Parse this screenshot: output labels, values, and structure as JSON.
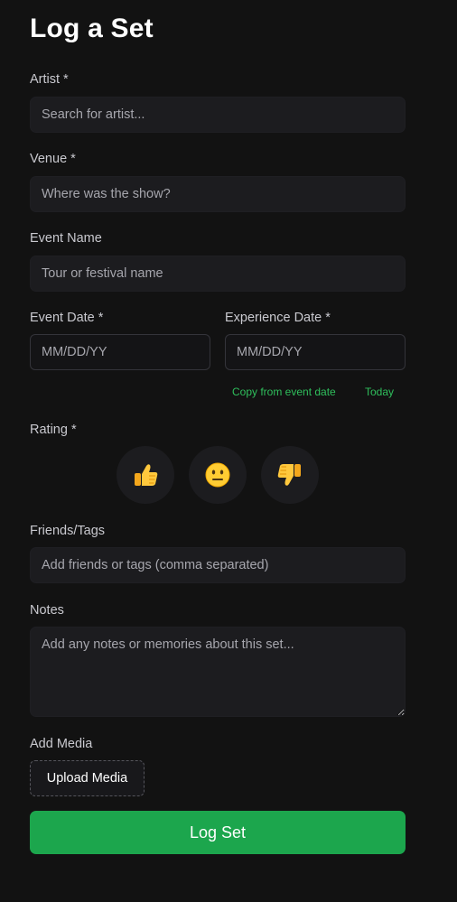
{
  "title": "Log a Set",
  "artist": {
    "label": "Artist *",
    "placeholder": "Search for artist..."
  },
  "venue": {
    "label": "Venue *",
    "placeholder": "Where was the show?"
  },
  "event_name": {
    "label": "Event Name",
    "placeholder": "Tour or festival name"
  },
  "event_date": {
    "label": "Event Date *",
    "placeholder": "MM/DD/YY"
  },
  "experience_date": {
    "label": "Experience Date *",
    "placeholder": "MM/DD/YY",
    "copy_link": "Copy from event date",
    "today_link": "Today"
  },
  "rating": {
    "label": "Rating *",
    "options": [
      {
        "icon": "thumbs-up-icon"
      },
      {
        "icon": "neutral-face-icon"
      },
      {
        "icon": "thumbs-down-icon"
      }
    ]
  },
  "friends_tags": {
    "label": "Friends/Tags",
    "placeholder": "Add friends or tags (comma separated)"
  },
  "notes": {
    "label": "Notes",
    "placeholder": "Add any notes or memories about this set..."
  },
  "media": {
    "label": "Add Media",
    "button": "Upload Media"
  },
  "submit": {
    "label": "Log Set"
  },
  "colors": {
    "accent": "#1ca64d",
    "link": "#2fbf5c",
    "background": "#121212",
    "field": "#1c1c1f"
  }
}
